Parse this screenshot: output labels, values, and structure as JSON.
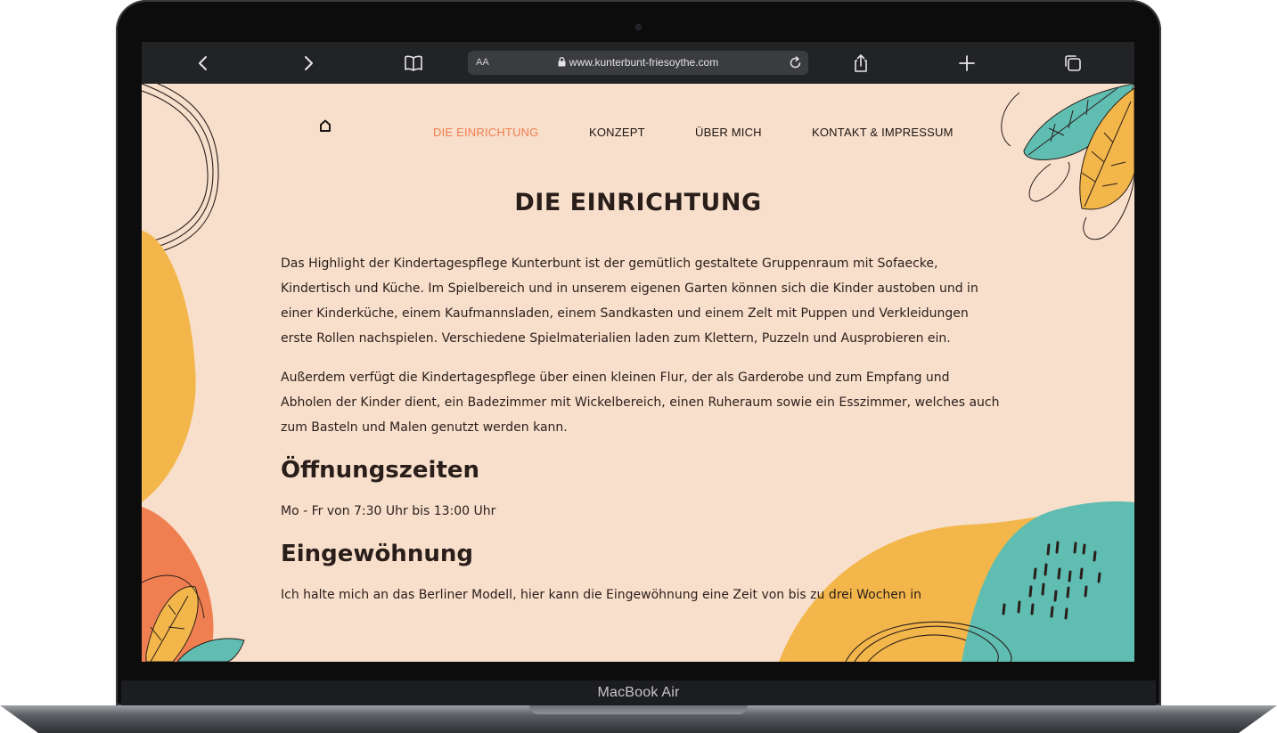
{
  "browser": {
    "text_size_label": "AA",
    "url": "www.kunterbunt-friesoythe.com",
    "icons": [
      "back-icon",
      "forward-icon",
      "bookmarks-icon",
      "lock-icon",
      "reload-icon",
      "share-icon",
      "new-tab-icon",
      "tabs-icon"
    ]
  },
  "nav": {
    "items": [
      {
        "label": "DIE EINRICHTUNG",
        "active": true
      },
      {
        "label": "KONZEPT",
        "active": false
      },
      {
        "label": "ÜBER MICH",
        "active": false
      },
      {
        "label": "KONTAKT & IMPRESSUM",
        "active": false
      }
    ]
  },
  "page": {
    "title": "DIE EINRICHTUNG",
    "paragraph_1": "Das Highlight der Kindertagespflege Kunterbunt ist der gemütlich gestaltete Gruppenraum mit Sofaecke, Kindertisch und Küche. Im Spielbereich und in unserem eigenen Garten können sich die Kinder austoben und in einer Kinderküche, einem Kaufmannsladen, einem Sandkasten und einem Zelt mit Puppen und Verkleidungen erste Rollen nachspielen. Verschiedene Spielmaterialien laden zum Klettern, Puzzeln und Ausprobieren ein.",
    "paragraph_2": "Außerdem verfügt die Kindertagespflege über einen kleinen Flur, der als Garderobe und zum Empfang und Abholen der Kinder dient, ein Badezimmer mit Wickelbereich, einen Ruheraum sowie ein Esszimmer, welches auch zum Basteln und Malen genutzt werden kann.",
    "heading_hours": "Öffnungszeiten",
    "hours_text": "Mo - Fr von 7:30 Uhr bis 13:00 Uhr",
    "heading_settling": "Eingewöhnung",
    "settling_text": "Ich halte mich an das Berliner Modell, hier kann die Eingewöhnung eine Zeit von bis zu drei Wochen in"
  },
  "device": {
    "label": "MacBook Air"
  },
  "colors": {
    "page_background": "#f8dfcb",
    "accent_orange": "#ef7f50",
    "mustard": "#f3b64a",
    "teal": "#5fbdb1",
    "text_dark": "#2a1e1b"
  }
}
